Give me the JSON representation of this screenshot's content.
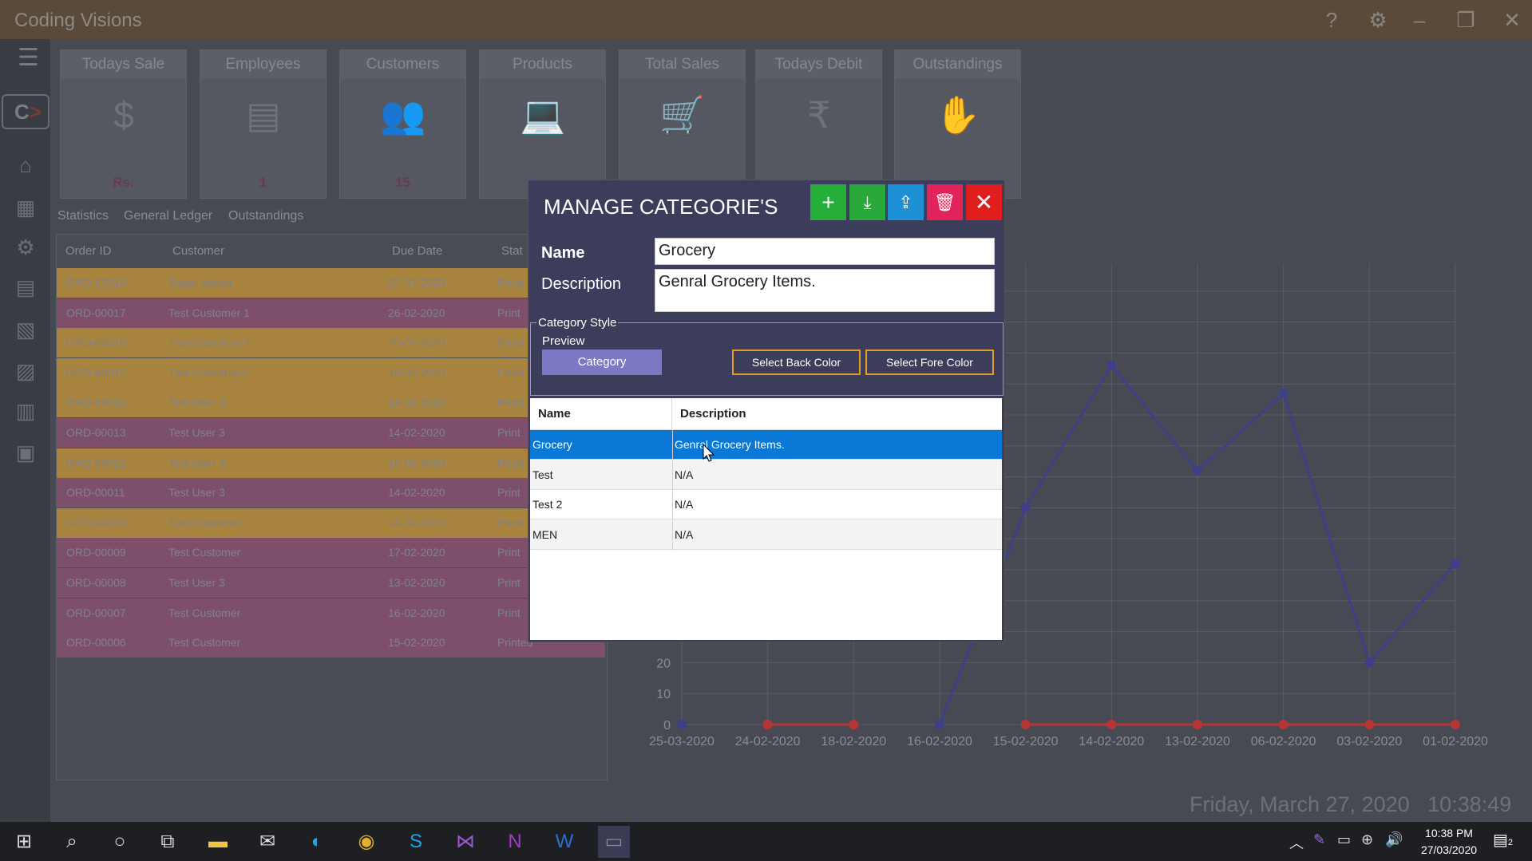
{
  "app": {
    "title": "Coding Visions"
  },
  "window_icons": [
    "help-icon",
    "settings-icon",
    "minimize-icon",
    "restore-icon",
    "close-icon"
  ],
  "sidebar": {
    "logo_text": "C",
    "items": [
      "home-icon",
      "products-icon",
      "settings-icon",
      "reports-icon",
      "search-report-icon",
      "chart-report-icon",
      "accounts-icon",
      "pos-icon"
    ]
  },
  "tiles": [
    {
      "title": "Todays Sale",
      "icon": "cash-register-icon",
      "value": "Rs."
    },
    {
      "title": "Employees",
      "icon": "id-card-icon",
      "value": "1"
    },
    {
      "title": "Customers",
      "icon": "users-icon",
      "value": "15"
    },
    {
      "title": "Products",
      "icon": "laptop-icon",
      "value": ""
    },
    {
      "title": "Total Sales",
      "icon": "cart-icon",
      "value": ""
    },
    {
      "title": "Todays Debit",
      "icon": "money-icon",
      "value": ""
    },
    {
      "title": "Outstandings",
      "icon": "hand-coin-icon",
      "value": ""
    }
  ],
  "tabs": [
    "Statistics",
    "General Ledger",
    "Outstandings"
  ],
  "orders": {
    "headers": [
      "Order ID",
      "Customer",
      "Due Date",
      "Stat"
    ],
    "rows": [
      {
        "id": "ORD-00018",
        "customer": "Sagar Maher",
        "due": "27-03-2020",
        "status": "Pend",
        "color": "#a8843e"
      },
      {
        "id": "ORD-00017",
        "customer": "Test Customer 1",
        "due": "26-02-2020",
        "status": "Print",
        "color": "#7e4f6b"
      },
      {
        "id": "ORD-00016",
        "customer": "Test Customer 2",
        "due": "20-02-2020",
        "status": "Pend",
        "color": "#a8843e"
      },
      {
        "id": "ORD-00015",
        "customer": "Test Customer 2",
        "due": "16-02-2020",
        "status": "Pend",
        "color": "#a8843e"
      },
      {
        "id": "ORD-00014",
        "customer": "Test User 3",
        "due": "14-02-2020",
        "status": "Pend",
        "color": "#a8843e"
      },
      {
        "id": "ORD-00013",
        "customer": "Test User 3",
        "due": "14-02-2020",
        "status": "Print",
        "color": "#7e4f6b"
      },
      {
        "id": "ORD-00012",
        "customer": "Test User 3",
        "due": "16-02-2020",
        "status": "Pend",
        "color": "#a8843e"
      },
      {
        "id": "ORD-00011",
        "customer": "Test User 3",
        "due": "14-02-2020",
        "status": "Print",
        "color": "#7e4f6b"
      },
      {
        "id": "ORD-00010",
        "customer": "Test Customer",
        "due": "14-02-2020",
        "status": "Pend",
        "color": "#a8843e"
      },
      {
        "id": "ORD-00009",
        "customer": "Test Customer",
        "due": "17-02-2020",
        "status": "Print",
        "color": "#7e4f6b"
      },
      {
        "id": "ORD-00008",
        "customer": "Test User 3",
        "due": "13-02-2020",
        "status": "Print",
        "color": "#7e4f6b"
      },
      {
        "id": "ORD-00007",
        "customer": "Test Customer",
        "due": "16-02-2020",
        "status": "Print",
        "color": "#7e4f6b"
      },
      {
        "id": "ORD-00006",
        "customer": "Test Customer",
        "due": "15-02-2020",
        "status": "Printed",
        "color": "#7e4f6b"
      }
    ]
  },
  "chart_data": {
    "type": "line",
    "x": [
      "25-03-2020",
      "24-02-2020",
      "18-02-2020",
      "16-02-2020",
      "15-02-2020",
      "14-02-2020",
      "13-02-2020",
      "06-02-2020",
      "03-02-2020",
      "01-02-2020"
    ],
    "y_ticks_visible": [
      0,
      10,
      20
    ],
    "series": [
      {
        "color": "#3d3f88",
        "values": [
          0,
          null,
          null,
          0,
          70,
          116,
          82,
          107,
          20,
          52
        ]
      },
      {
        "color": "#b93535",
        "values": [
          null,
          0,
          0,
          null,
          0,
          0,
          0,
          0,
          0,
          0
        ]
      }
    ],
    "grid": true
  },
  "footer": {
    "date": "Friday, March 27, 2020",
    "time": "10:38:49"
  },
  "dialog": {
    "title": "MANAGE CATEGORIE'S",
    "buttons": [
      {
        "icon": "add-icon",
        "color": "#27ae3a"
      },
      {
        "icon": "save-icon",
        "color": "#2aa83c"
      },
      {
        "icon": "export-icon",
        "color": "#1e90d6"
      },
      {
        "icon": "delete-icon",
        "color": "#e2245a"
      },
      {
        "icon": "close-icon",
        "color": "#e01e1e"
      }
    ],
    "name_label": "Name",
    "name_value": "Grocery",
    "description_label": "Description",
    "description_value": "Genral Grocery Items.",
    "style_group_label": "Category Style",
    "preview_label": "Preview",
    "preview_chip": "Category",
    "back_color_button": "Select Back Color",
    "fore_color_button": "Select Fore Color",
    "grid": {
      "headers": [
        "Name",
        "Description"
      ],
      "rows": [
        {
          "name": "Grocery",
          "description": "Genral Grocery Items.",
          "selected": true
        },
        {
          "name": "Test",
          "description": "N/A",
          "selected": false
        },
        {
          "name": "Test 2",
          "description": "N/A",
          "selected": false
        },
        {
          "name": "MEN",
          "description": "N/A",
          "selected": false
        }
      ]
    }
  },
  "taskbar": {
    "icons": [
      "windows-start-icon",
      "search-icon",
      "cortana-icon",
      "task-view-icon",
      "file-explorer-icon",
      "mail-icon",
      "edge-icon",
      "chrome-icon",
      "skype-icon",
      "visual-studio-icon",
      "onenote-icon",
      "word-icon",
      "app-icon"
    ],
    "tray_icons": [
      "chevron-up-icon",
      "pen-icon",
      "battery-icon",
      "network-icon",
      "volume-icon",
      "notification-icon"
    ],
    "time": "10:38 PM",
    "date": "27/03/2020",
    "notification_count": "2"
  }
}
